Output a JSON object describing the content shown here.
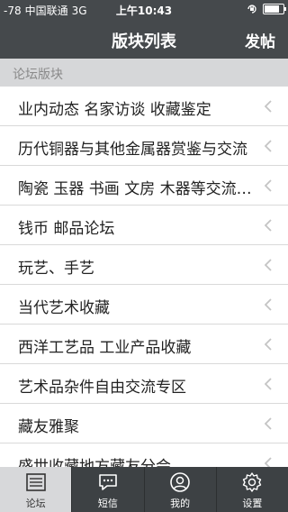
{
  "status_bar": {
    "signal": "-78",
    "carrier": "中国联通",
    "network": "3G",
    "time": "上午10:43",
    "battery_level": 0.9
  },
  "nav": {
    "title": "版块列表",
    "post_label": "发帖"
  },
  "section": {
    "title": "论坛版块"
  },
  "forums": [
    {
      "label": "业内动态 名家访谈 收藏鉴定"
    },
    {
      "label": "历代铜器与其他金属器赏鉴与交流"
    },
    {
      "label": "陶瓷 玉器 书画 文房 木器等交流…"
    },
    {
      "label": "钱币 邮品论坛"
    },
    {
      "label": "玩艺、手艺"
    },
    {
      "label": "当代艺术收藏"
    },
    {
      "label": "西洋工艺品 工业产品收藏"
    },
    {
      "label": "艺术品杂件自由交流专区"
    },
    {
      "label": "藏友雅聚"
    },
    {
      "label": "盛世收藏地方藏友分会"
    }
  ],
  "tabs": [
    {
      "label": "论坛",
      "icon": "forum-list-icon",
      "active": true
    },
    {
      "label": "短信",
      "icon": "message-icon",
      "active": false
    },
    {
      "label": "我的",
      "icon": "profile-icon",
      "active": false
    },
    {
      "label": "设置",
      "icon": "settings-gear-icon",
      "active": false
    }
  ],
  "colors": {
    "bar_background": "#45494c",
    "section_background": "#d6d7d9",
    "tab_background": "#3d4144",
    "active_tab_background": "#d7d8da"
  }
}
